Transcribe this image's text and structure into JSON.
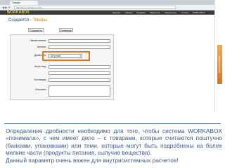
{
  "browser": {
    "tab_title": "Товары",
    "url": "http://www.workabox.ru/?tq_...",
    "nav": "◀ ▶ ⟳"
  },
  "app": {
    "logo": "WORKABOX",
    "menu": [
      "Закупки",
      "Запасы",
      "Продажи",
      "Маркетинг",
      "Управление",
      "Отчеты",
      "WORKABOX"
    ]
  },
  "page": {
    "breadcrumb_parent": "Создается",
    "breadcrumb_sep": "-",
    "breadcrumb_current": "Товары",
    "buttons": {
      "save": "Сохранить",
      "cancel": "Отменить"
    },
    "fields": {
      "name_label": "Наименование:",
      "article_label": "Артикул:",
      "divisibility_label": "Дробность:",
      "divisibility_value": "Штучный",
      "barcode_label": "Штрих-код:",
      "supplier_label": "Поставщик:",
      "description_label": "Описание:"
    }
  },
  "side_label": "Автоматизация",
  "caption": {
    "paragraph": "Определение дробности необходимо для того, чтобы система WORKABOX «понимала», с чем имеет дело – с товарами, которые считаются поштучно (банками, упаковками) или теми, которые могут быть подробнены на более мелкие части (продукты питания, сыпучие вещества).",
    "note": "Данный параметр очень важен для внутрисистемных расчетов!"
  },
  "colors": {
    "accent": "#e8781e",
    "header": "#3a3a3a",
    "caption_text": "#3a5a8a"
  }
}
